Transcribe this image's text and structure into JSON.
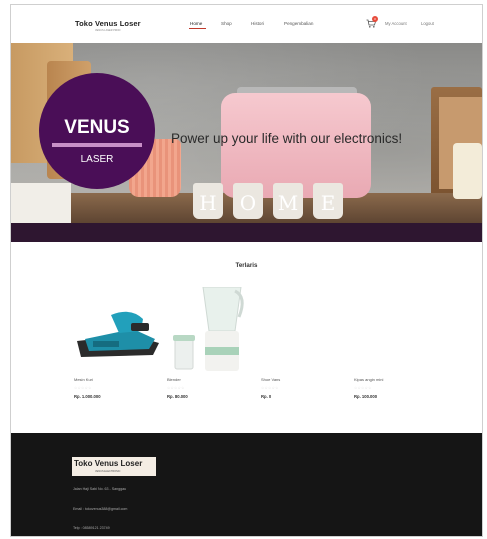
{
  "header": {
    "logo": "Toko Venus Loser",
    "logo_sub": "VENUS LASER PROD",
    "nav": [
      {
        "label": "Home",
        "active": true
      },
      {
        "label": "Shop",
        "active": false
      },
      {
        "label": "Histori",
        "active": false
      },
      {
        "label": "Pengembalian",
        "active": false
      }
    ],
    "cart_count": "0",
    "my_account": "My Account",
    "logout": "Logout"
  },
  "hero": {
    "badge_title": "VENUS",
    "badge_sub": "LASER",
    "tagline": "Power up your life with our electronics!",
    "cup_letters": [
      "H",
      "O",
      "M",
      "E"
    ]
  },
  "products_section": {
    "title": "Terlaris",
    "items": [
      {
        "name": "Mesin Kuri",
        "stars": "☆☆☆☆☆",
        "price": "Rp. 1.000.000"
      },
      {
        "name": "Blender",
        "stars": "☆☆☆☆☆",
        "price": "Rp. 80.000"
      },
      {
        "name": "Shoe Vans",
        "stars": "☆☆☆☆☆",
        "price": "Rp. 0"
      },
      {
        "name": "Kipas angin mini",
        "stars": "☆☆☆☆☆",
        "price": "Rp. 100.000"
      }
    ]
  },
  "footer": {
    "logo": "Toko Venus Loser",
    "logo_sub": "VENUS ELECTRONIC",
    "address": "Jalan Haji Sabi No. 63 - Sanggau",
    "email": "Email : tokovenus388@gmail.com",
    "phone": "Telp : 08589121 23749"
  },
  "colors": {
    "accent_purple": "#4a0e57",
    "band_purple": "#2e1630",
    "nav_active_underline": "#c0392b",
    "footer_bg": "#151515"
  }
}
